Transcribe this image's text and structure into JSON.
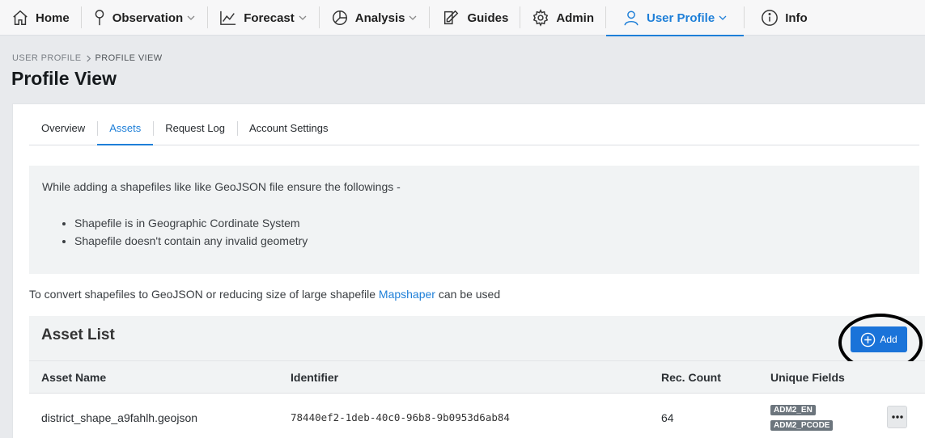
{
  "nav": {
    "home": "Home",
    "observation": "Observation",
    "forecast": "Forecast",
    "analysis": "Analysis",
    "guides": "Guides",
    "admin": "Admin",
    "user_profile": "User Profile",
    "info": "Info"
  },
  "breadcrumb": {
    "parent": "USER PROFILE",
    "current": "PROFILE VIEW"
  },
  "page_title": "Profile View",
  "tabs": [
    "Overview",
    "Assets",
    "Request Log",
    "Account Settings"
  ],
  "active_tab": "Assets",
  "notice": {
    "intro": "While adding a shapefiles like like GeoJSON file ensure the followings -",
    "bullets": [
      "Shapefile is in Geographic Cordinate System",
      "Shapefile doesn't contain any invalid geometry"
    ]
  },
  "convert": {
    "before": "To convert shapefiles to GeoJSON or reducing size of large shapefile ",
    "link": "Mapshaper",
    "after": " can be used"
  },
  "asset_list": {
    "title": "Asset List",
    "add_label": "Add",
    "columns": [
      "Asset Name",
      "Identifier",
      "Rec. Count",
      "Unique Fields"
    ],
    "rows": [
      {
        "name": "district_shape_a9fahlh.geojson",
        "identifier": "78440ef2-1deb-40c0-96b8-9b0953d6ab84",
        "count": "64",
        "fields": [
          "ADM2_EN",
          "ADM2_PCODE"
        ]
      }
    ]
  },
  "colors": {
    "accent": "#1e7fd8",
    "button": "#1a73d9",
    "badge": "#6c757d"
  },
  "icons": [
    "home-icon",
    "map-pin-icon",
    "chart-line-icon",
    "pie-chart-icon",
    "edit-icon",
    "gear-icon",
    "user-icon",
    "info-icon",
    "plus-circle-icon",
    "more-icon"
  ]
}
